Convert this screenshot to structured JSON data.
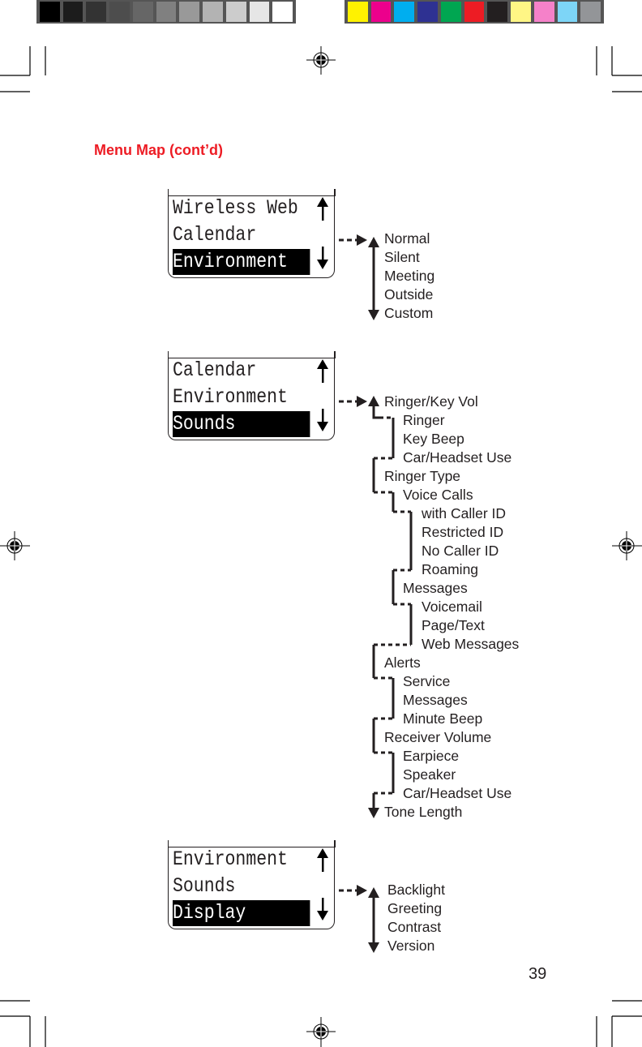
{
  "color_bars": {
    "grayscale": [
      "#000000",
      "#1c1c1c",
      "#333333",
      "#4d4d4d",
      "#666666",
      "#808080",
      "#999999",
      "#b3b3b3",
      "#cccccc",
      "#e6e6e6",
      "#ffffff"
    ],
    "process": [
      "#fff200",
      "#ec008c",
      "#00aeef",
      "#2e3192",
      "#00a651",
      "#ed1c24",
      "#231f20",
      "#fff685",
      "#f581c9",
      "#7dd5f7",
      "#939598"
    ]
  },
  "header": {
    "title": "Menu Map (cont’d)",
    "title_color": "#ed1c24"
  },
  "sections": [
    {
      "screen": {
        "lines": [
          "Wireless Web",
          "Calendar",
          "Environment"
        ],
        "selected_index": 2
      },
      "submenu": [
        "Normal",
        "Silent",
        "Meeting",
        "Outside",
        "Custom"
      ]
    },
    {
      "screen": {
        "lines": [
          "Calendar",
          "Environment",
          "Sounds"
        ],
        "selected_index": 2
      },
      "submenu": [
        {
          "label": "Ringer/Key Vol",
          "level": 0
        },
        {
          "label": "Ringer",
          "level": 1
        },
        {
          "label": "Key Beep",
          "level": 1
        },
        {
          "label": "Car/Headset Use",
          "level": 1
        },
        {
          "label": "Ringer Type",
          "level": 0
        },
        {
          "label": "Voice Calls",
          "level": 1
        },
        {
          "label": "with Caller ID",
          "level": 2
        },
        {
          "label": "Restricted ID",
          "level": 2
        },
        {
          "label": "No Caller ID",
          "level": 2
        },
        {
          "label": "Roaming",
          "level": 2
        },
        {
          "label": "Messages",
          "level": 1
        },
        {
          "label": "Voicemail",
          "level": 2
        },
        {
          "label": "Page/Text",
          "level": 2
        },
        {
          "label": "Web Messages",
          "level": 2
        },
        {
          "label": "Alerts",
          "level": 0
        },
        {
          "label": "Service",
          "level": 1
        },
        {
          "label": "Messages",
          "level": 1
        },
        {
          "label": "Minute Beep",
          "level": 1
        },
        {
          "label": "Receiver Volume",
          "level": 0
        },
        {
          "label": "Earpiece",
          "level": 1
        },
        {
          "label": "Speaker",
          "level": 1
        },
        {
          "label": "Car/Headset Use",
          "level": 1
        },
        {
          "label": "Tone Length",
          "level": 0
        }
      ]
    },
    {
      "screen": {
        "lines": [
          "Environment",
          "Sounds",
          "Display"
        ],
        "selected_index": 2
      },
      "submenu": [
        "Backlight",
        "Greeting",
        "Contrast",
        "Version"
      ]
    }
  ],
  "icons": {
    "scroll_up": "up-arrow-icon",
    "scroll_down": "down-arrow-icon",
    "registration": "registration-mark-icon"
  },
  "footer": {
    "page_number": "39"
  }
}
